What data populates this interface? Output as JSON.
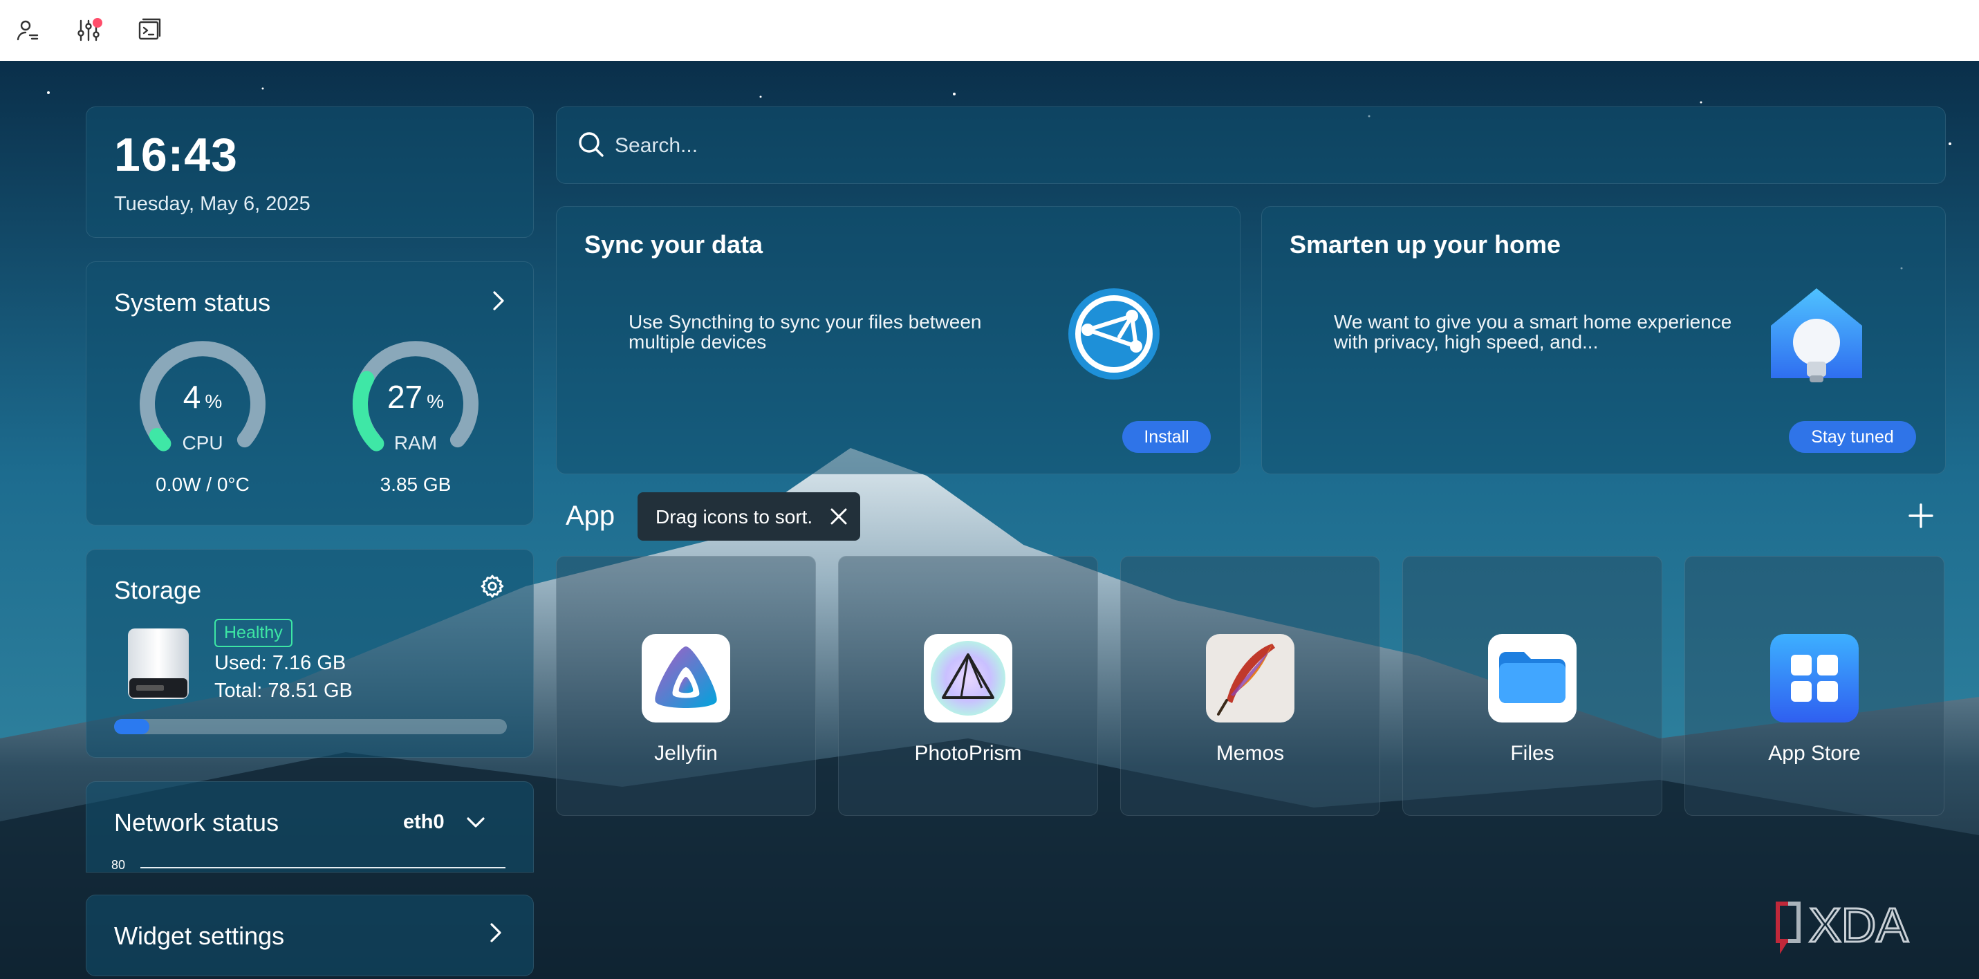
{
  "topbar": {
    "icons": [
      "user-settings-icon",
      "sliders-icon",
      "terminal-icon"
    ]
  },
  "clock": {
    "time": "16:43",
    "date": "Tuesday, May 6, 2025"
  },
  "system_status": {
    "title": "System status",
    "cpu": {
      "value": "4",
      "unit": "%",
      "label": "CPU",
      "sub": "0.0W / 0°C",
      "fraction": 0.04
    },
    "ram": {
      "value": "27",
      "unit": "%",
      "label": "RAM",
      "sub": "3.85 GB",
      "fraction": 0.27
    }
  },
  "storage": {
    "title": "Storage",
    "status": "Healthy",
    "used": "Used: 7.16 GB",
    "total": "Total: 78.51 GB",
    "fraction": 0.09
  },
  "network": {
    "title": "Network status",
    "interface": "eth0",
    "tick": "80"
  },
  "widget_settings": {
    "title": "Widget settings"
  },
  "search": {
    "placeholder": "Search..."
  },
  "promos": [
    {
      "title": "Sync your data",
      "desc": "Use Syncthing to sync your files between multiple devices",
      "button": "Install"
    },
    {
      "title": "Smarten up your home",
      "desc": "We want to give you a smart home experience with privacy, high speed, and...",
      "button": "Stay tuned"
    }
  ],
  "apps_section": {
    "title": "App",
    "tooltip": "Drag icons to sort.",
    "apps": [
      {
        "name": "Jellyfin"
      },
      {
        "name": "PhotoPrism"
      },
      {
        "name": "Memos"
      },
      {
        "name": "Files"
      },
      {
        "name": "App Store"
      }
    ]
  },
  "watermark": {
    "text": "XDA"
  },
  "colors": {
    "accent": "#2f74e8",
    "healthy": "#3de6a4",
    "gauge": "#3fe7a6"
  }
}
